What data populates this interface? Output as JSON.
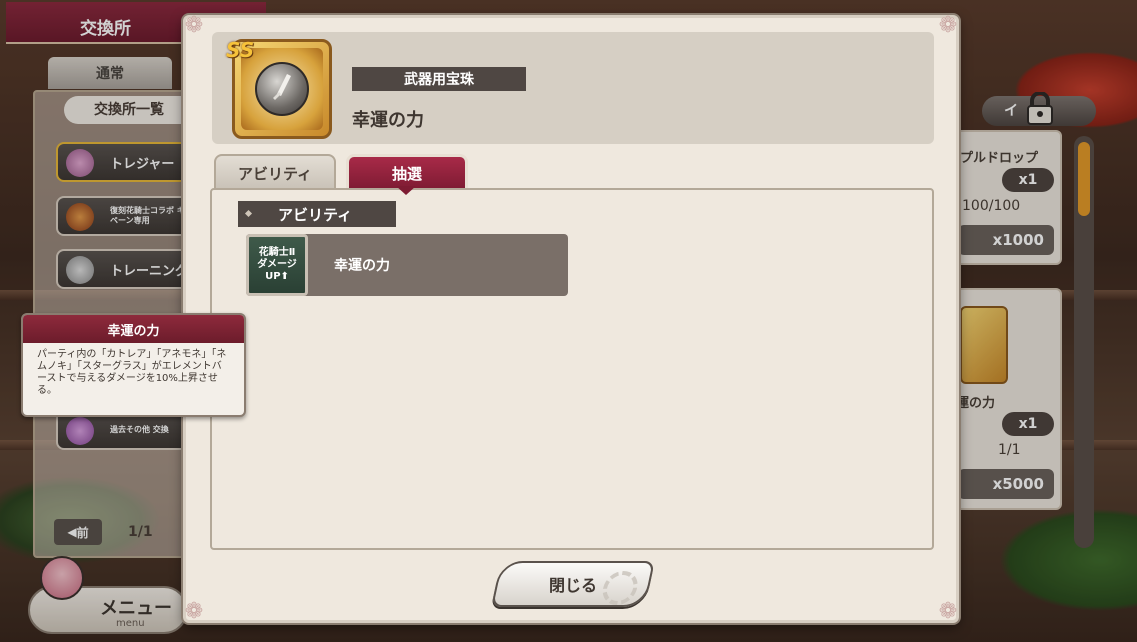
{
  "background": {
    "exchange_title": "交換所",
    "tab_normal": "通常",
    "list_title": "交換所一覧",
    "left_items": [
      {
        "label": "トレジャー"
      },
      {
        "label": "復刻花騎士コラボ キャンペーン専用"
      },
      {
        "label": "トレーニング"
      },
      {
        "label": "過去その他 交換"
      }
    ],
    "pager": {
      "prev_label": "前",
      "page": "1/1"
    },
    "menu": {
      "label": "メニュー",
      "sub": "menu"
    },
    "right_panel": {
      "lock_label": "イ",
      "card1": {
        "name": "プルドロップ",
        "qty": "x1",
        "stock": "100/100",
        "cost": "x1000"
      },
      "card2": {
        "name": "運の力",
        "qty": "x1",
        "stock": "1/1",
        "cost": "x5000"
      }
    }
  },
  "tooltip": {
    "title": "幸運の力",
    "body": "パーティ内の「カトレア」「アネモネ」「ネムノキ」「スターグラス」がエレメントバーストで与えるダメージを10%上昇させる。"
  },
  "modal": {
    "rank": "SS",
    "category": "武器用宝珠",
    "item_name": "幸運の力",
    "tabs": [
      {
        "label": "アビリティ"
      },
      {
        "label": "抽選"
      }
    ],
    "section_label": "アビリティ",
    "ability": {
      "icon_lines": [
        "花騎士Ⅱ",
        "ダメージ",
        "UP⬆"
      ],
      "name": "幸運の力"
    },
    "close_label": "閉じる"
  }
}
